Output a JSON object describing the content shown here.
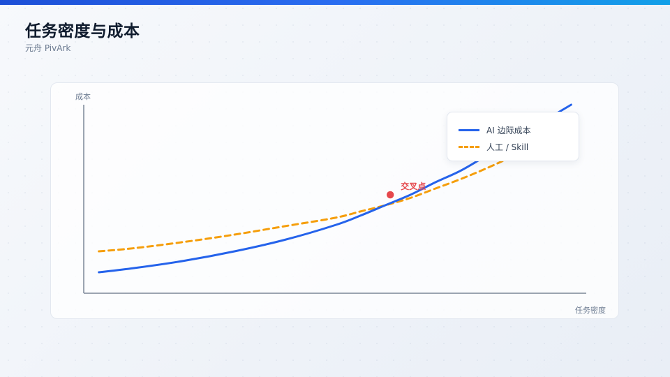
{
  "page": {
    "title": "任务密度与成本",
    "subtitle": "元舟 PivArk"
  },
  "colors": {
    "accent_bar": "#2563eb",
    "ai_line": "#2563eb",
    "human_line": "#f59e0b",
    "crossover_point": "#e5484d",
    "axis": "#7b8797"
  },
  "chart_data": {
    "type": "line",
    "title": "",
    "xlabel": "任务密度",
    "ylabel": "成本",
    "xlim": [
      0,
      100
    ],
    "ylim": [
      0,
      100
    ],
    "grid": false,
    "legend_position": "top-right",
    "series": [
      {
        "name": "AI 边际成本",
        "style": "solid",
        "x": [
          3,
          10,
          20,
          30,
          40,
          50,
          55,
          60,
          65,
          70,
          75,
          80,
          85,
          90,
          97
        ],
        "y": [
          10,
          12,
          15.5,
          20,
          25.5,
          32.5,
          37,
          42,
          47,
          53,
          58.5,
          65.5,
          72.5,
          80,
          90
        ]
      },
      {
        "name": "人工 / Skill",
        "style": "dashed",
        "x": [
          3,
          10,
          20,
          30,
          40,
          50,
          55,
          60,
          65,
          70,
          75,
          80,
          85,
          90
        ],
        "y": [
          20,
          21.5,
          24.5,
          28,
          32,
          36,
          39,
          42,
          45.5,
          50,
          54.5,
          59.5,
          65,
          71
        ]
      }
    ],
    "annotations": [
      {
        "label": "交叉点",
        "x": 61,
        "y": 47
      }
    ]
  }
}
